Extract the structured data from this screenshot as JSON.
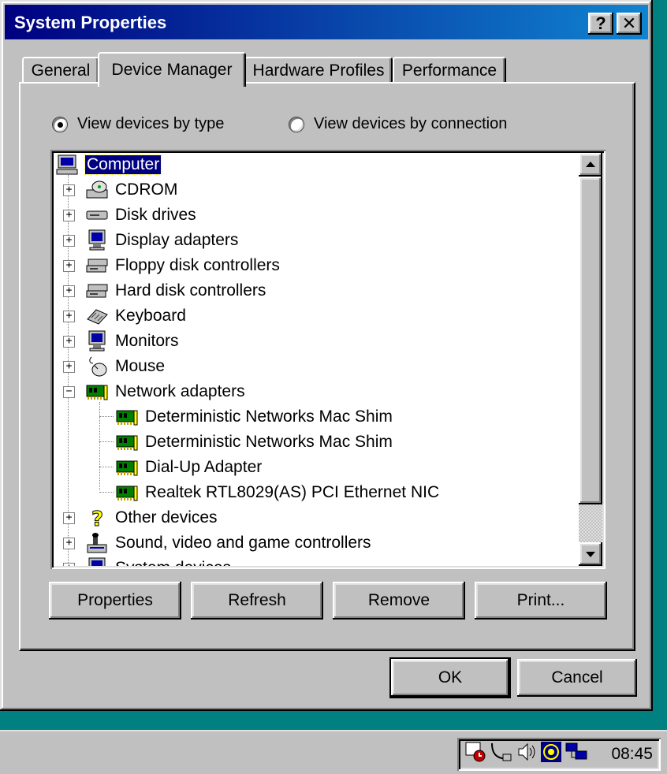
{
  "window": {
    "title": "System Properties",
    "help_button": "?",
    "close_button": "✕"
  },
  "tabs": [
    {
      "label": "General",
      "active": false
    },
    {
      "label": "Device Manager",
      "active": true
    },
    {
      "label": "Hardware Profiles",
      "active": false
    },
    {
      "label": "Performance",
      "active": false
    }
  ],
  "view_options": {
    "by_type": {
      "label": "View devices by type",
      "selected": true
    },
    "by_connection": {
      "label": "View devices by connection",
      "selected": false
    }
  },
  "tree": {
    "root": {
      "label": "Computer",
      "icon": "computer-icon"
    },
    "items": [
      {
        "label": "CDROM",
        "icon": "cdrom-icon",
        "expanded": false
      },
      {
        "label": "Disk drives",
        "icon": "disk-drive-icon",
        "expanded": false
      },
      {
        "label": "Display adapters",
        "icon": "display-adapter-icon",
        "expanded": false
      },
      {
        "label": "Floppy disk controllers",
        "icon": "floppy-controller-icon",
        "expanded": false
      },
      {
        "label": "Hard disk controllers",
        "icon": "hard-disk-controller-icon",
        "expanded": false
      },
      {
        "label": "Keyboard",
        "icon": "keyboard-icon",
        "expanded": false
      },
      {
        "label": "Monitors",
        "icon": "monitor-icon",
        "expanded": false
      },
      {
        "label": "Mouse",
        "icon": "mouse-icon",
        "expanded": false
      },
      {
        "label": "Network adapters",
        "icon": "network-adapter-icon",
        "expanded": true,
        "children": [
          {
            "label": "Deterministic Networks Mac Shim",
            "icon": "network-card-icon"
          },
          {
            "label": "Deterministic Networks Mac Shim",
            "icon": "network-card-icon"
          },
          {
            "label": "Dial-Up Adapter",
            "icon": "network-card-icon"
          },
          {
            "label": "Realtek RTL8029(AS) PCI Ethernet NIC",
            "icon": "network-card-icon"
          }
        ]
      },
      {
        "label": "Other devices",
        "icon": "question-icon",
        "expanded": false
      },
      {
        "label": "Sound, video and game controllers",
        "icon": "sound-controller-icon",
        "expanded": false
      },
      {
        "label": "System devices",
        "icon": "system-devices-icon",
        "expanded": false
      }
    ]
  },
  "buttons": {
    "properties": "Properties",
    "refresh": "Refresh",
    "remove": "Remove",
    "print": "Print...",
    "ok": "OK",
    "cancel": "Cancel"
  },
  "taskbar": {
    "clock": "08:45",
    "tray_icons": [
      "scheduler-icon",
      "network-connection-icon",
      "volume-icon",
      "wireless-icon",
      "network-tray-icon"
    ]
  },
  "colors": {
    "desktop": "#008080",
    "title_bar": "#000080",
    "face": "#c0c0c0",
    "selection": "#000080"
  }
}
